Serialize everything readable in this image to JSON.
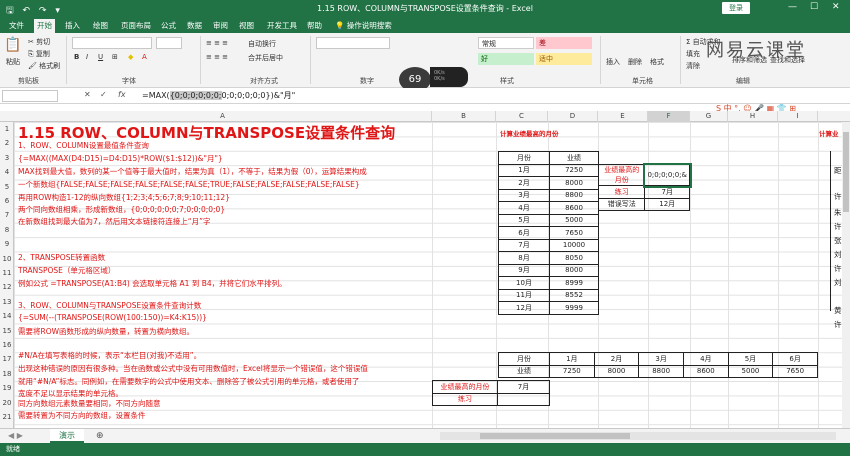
{
  "window": {
    "title": "1.15 ROW、COLUMN与TRANSPOSE设置条件查询 - Excel",
    "login": "登录",
    "quick_access": "🖫 ↶ ↷ ▾",
    "min": "—",
    "max": "☐",
    "close": "✕"
  },
  "tabs": [
    "文件",
    "开始",
    "插入",
    "绘图",
    "页面布局",
    "公式",
    "数据",
    "审阅",
    "视图",
    "开发工具",
    "帮助",
    "💡 操作说明搜索"
  ],
  "ribbon": {
    "paste": "粘贴",
    "cut": "✂ 剪切",
    "copy": "⎘ 复制",
    "format_painter": "🖌 格式刷",
    "clipboard": "剪贴板",
    "font": "字体",
    "alignment": "对齐方式",
    "number": "数字",
    "styles": "样式",
    "cells": "单元格",
    "editing": "编辑",
    "wrap": "自动换行",
    "merge": "合并后居中",
    "normal": "常规",
    "bad": "差",
    "good": "好",
    "neutral": "适中",
    "insert": "插入",
    "delete": "删除",
    "format": "格式",
    "sum": "Σ 自动求和",
    "fill": "填充",
    "clear": "清除",
    "sort": "排序和筛选",
    "find": "查找和选择",
    "watermark": "网易云课堂",
    "badge": "69",
    "speed_up": "0K/s",
    "speed_down": "0K/s"
  },
  "formula_bar": {
    "fx": "fx",
    "pre": "=MAX(",
    "hl": "{0;0;0;0;0;0;",
    "post": "0;0;0;0;0;0}",
    "tail": ")&\"月\""
  },
  "sogou": "S 中 °, ☺ 🎤 ▦ 👕 ⊞",
  "cols": [
    "A",
    "B",
    "C",
    "D",
    "E",
    "F",
    "G",
    "H",
    "I"
  ],
  "rows": [
    "1",
    "2",
    "3",
    "4",
    "5",
    "6",
    "7",
    "8",
    "9",
    "10",
    "11",
    "12",
    "13",
    "14",
    "15",
    "16",
    "17",
    "18",
    "19",
    "20",
    "21"
  ],
  "notes": {
    "title": "1.15 ROW、COLUMN与TRANSPOSE设置条件查询",
    "l2": "1、ROW、COLUMN设置最值条件查询",
    "l3": "{=MAX((MAX(D4:D15)=D4:D15)*ROW($1:$12))&\"月\"}",
    "l4": "MAX找到最大值，数列的某一个值等于最大值时，结果为真（1），不等于，结果为假（0），运算结果构成",
    "l5": "一个新数组{FALSE;FALSE;FALSE;FALSE;FALSE;FALSE;TRUE;FALSE;FALSE;FALSE;FALSE;FALSE}",
    "l6": "再用ROW构造1-12的纵向数组{1;2;3;4;5;6;7;8;9;10;11;12}",
    "l7": "两个同向数组相乘，形成新数组，{0;0;0;0;0;0;7;0;0;0;0;0}",
    "l8": "在新数组找到最大值为7，然后用文本链接符连接上“月”字",
    "l11": "2、TRANSPOSE转置函数",
    "l12": "TRANSPOSE（单元格区域）",
    "l13": "例如公式 =TRANSPOSE(A1:B4) 会选取单元格 A1 到 B4，并将它们水平排列。",
    "l15": "3、ROW、COLUMN与TRANSPOSE设置条件查询计数",
    "l16": "{=SUM(--(TRANSPOSE(ROW(100:150))=K4:K15))}",
    "l17": "需要将ROW函数形成的纵向数量，转置为横向数组。",
    "l19": "#N/A在填写表格的时候，表示“本栏目(对我)不适用”。",
    "l20": "出现这种错误的原因有很多种。当在函数或公式中没有可用数值时，Excel将显示一个错误值，这个错误值",
    "l21": "就用“#N/A”标志。同例如，在需要数字的公式中使用文本、删除答了被公式引用的单元格，或者使用了",
    "l22": "宽度不足以显示结果的单元格。",
    "l23": "同方向数组元素数量要相同，不同方向随意",
    "l24": "需要转置为不同方向的数组，设置条件"
  },
  "table1": {
    "title": "计算业绩最高的月份",
    "header": [
      "月份",
      "业绩"
    ],
    "rows": [
      [
        "1月",
        "7250"
      ],
      [
        "2月",
        "8000"
      ],
      [
        "3月",
        "8800"
      ],
      [
        "4月",
        "8600"
      ],
      [
        "5月",
        "5000"
      ],
      [
        "6月",
        "7650"
      ],
      [
        "7月",
        "10000"
      ],
      [
        "8月",
        "8050"
      ],
      [
        "9月",
        "8000"
      ],
      [
        "10月",
        "8999"
      ],
      [
        "11月",
        "8552"
      ],
      [
        "12月",
        "9999"
      ]
    ]
  },
  "lookup": {
    "label": "业绩最高的月份",
    "value": "0;0;0;0;0;&",
    "practice": "练习",
    "practice_val": "7月",
    "wrong": "错误写法",
    "wrong_val": "12月"
  },
  "table2": {
    "months": [
      "月份",
      "1月",
      "2月",
      "3月",
      "4月",
      "5月",
      "6月"
    ],
    "values": [
      "业绩",
      "7250",
      "8000",
      "8800",
      "8600",
      "5000",
      "7650"
    ],
    "label": "业绩最高的月份",
    "answer": "7月",
    "practice": "练习"
  },
  "side": {
    "title": "计算业",
    "chars": [
      "距",
      "许",
      "朱",
      "许",
      "张",
      "刘",
      "许",
      "刘",
      "黄",
      "许"
    ]
  },
  "sheet": {
    "name": "演示",
    "add": "⊕"
  },
  "status": "就绪"
}
